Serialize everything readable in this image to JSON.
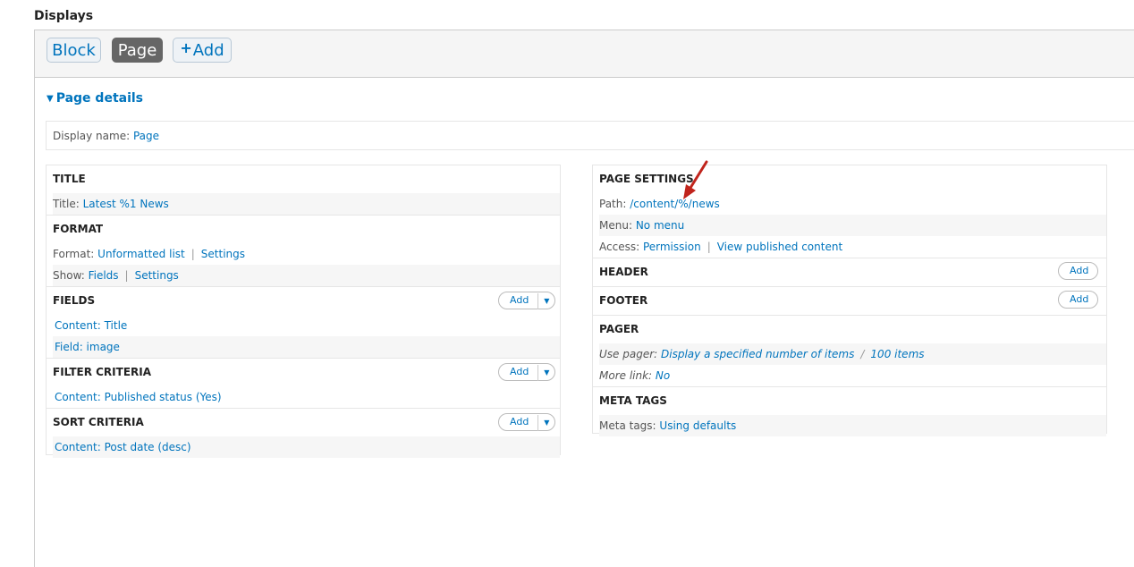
{
  "header": {
    "title": "Displays"
  },
  "tabs": {
    "block": "Block",
    "page": "Page",
    "add_plus": "+",
    "add": "Add"
  },
  "details": {
    "toggle_icon": "triangle-down",
    "toggle_label": "Page details"
  },
  "display_name": {
    "label": "Display name:",
    "value": "Page"
  },
  "left": {
    "title": {
      "heading": "TITLE",
      "label": "Title:",
      "value": "Latest %1 News"
    },
    "format": {
      "heading": "FORMAT",
      "format_label": "Format:",
      "format_value": "Unformatted list",
      "format_settings": "Settings",
      "show_label": "Show:",
      "show_value": "Fields",
      "show_settings": "Settings"
    },
    "fields": {
      "heading": "FIELDS",
      "add": "Add",
      "items": [
        "Content: Title",
        "Field: image"
      ]
    },
    "filter": {
      "heading": "FILTER CRITERIA",
      "add": "Add",
      "items": [
        "Content: Published status (Yes)"
      ]
    },
    "sort": {
      "heading": "SORT CRITERIA",
      "add": "Add",
      "items": [
        "Content: Post date (desc)"
      ]
    }
  },
  "right": {
    "page_settings": {
      "heading": "PAGE SETTINGS",
      "path_label": "Path:",
      "path_value": "/content/%/news",
      "menu_label": "Menu:",
      "menu_value": "No menu",
      "access_label": "Access:",
      "access_value": "Permission",
      "access_value2": "View published content"
    },
    "header": {
      "heading": "HEADER",
      "add": "Add"
    },
    "footer": {
      "heading": "FOOTER",
      "add": "Add"
    },
    "pager": {
      "heading": "PAGER",
      "use_label": "Use pager:",
      "use_value": "Display a specified number of items",
      "use_items": "100 items",
      "more_label": "More link:",
      "more_value": "No"
    },
    "meta": {
      "heading": "META TAGS",
      "label": "Meta tags:",
      "value": "Using defaults"
    }
  },
  "colors": {
    "link": "#0074bd",
    "active_tab": "#666666",
    "annotation_arrow": "#c0241c"
  }
}
